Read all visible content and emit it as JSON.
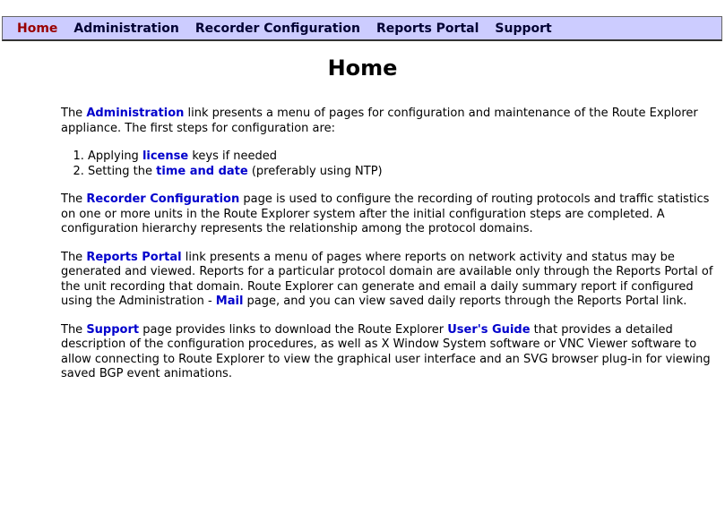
{
  "nav": {
    "items": [
      {
        "label": "Home",
        "active": true
      },
      {
        "label": "Administration",
        "active": false
      },
      {
        "label": "Recorder Configuration",
        "active": false
      },
      {
        "label": "Reports Portal",
        "active": false
      },
      {
        "label": "Support",
        "active": false
      }
    ]
  },
  "page": {
    "title": "Home"
  },
  "para1": {
    "t1": "The ",
    "link": "Administration",
    "t2": " link presents a menu of pages for configuration and maintenance of the Route Explorer appliance. The first steps for configuration are:"
  },
  "steps": [
    {
      "t1": "Applying ",
      "link": "license",
      "t2": " keys if needed"
    },
    {
      "t1": "Setting the ",
      "link": "time and date",
      "t2": " (preferably using NTP)"
    }
  ],
  "para2": {
    "t1": "The ",
    "link": "Recorder Configuration",
    "t2": " page is used to configure the recording of routing protocols and traffic statistics on one or more units in the Route Explorer system after the initial configuration steps are completed. A configuration hierarchy represents the relationship among the protocol domains."
  },
  "para3": {
    "t1": "The ",
    "link": "Reports Portal",
    "t2": " link presents a menu of pages where reports on network activity and status may be generated and viewed. Reports for a particular protocol domain are available only through the Reports Portal of the unit recording that domain. Route Explorer can generate and email a daily summary report if configured using the Administration - ",
    "link2": "Mail",
    "t3": " page, and you can view saved daily reports through the Reports Portal link."
  },
  "para4": {
    "t1": "The ",
    "link": "Support",
    "t2": " page provides links to download the Route Explorer ",
    "link2": "User's Guide",
    "t3": " that provides a detailed description of the configuration procedures, as well as X Window System software or VNC Viewer software to allow connecting to Route Explorer to view the graphical user interface and an SVG browser plug-in for viewing saved BGP event animations."
  },
  "colors": {
    "nav_background": "#ccccff",
    "nav_active": "#990000",
    "link": "#0000cc"
  }
}
